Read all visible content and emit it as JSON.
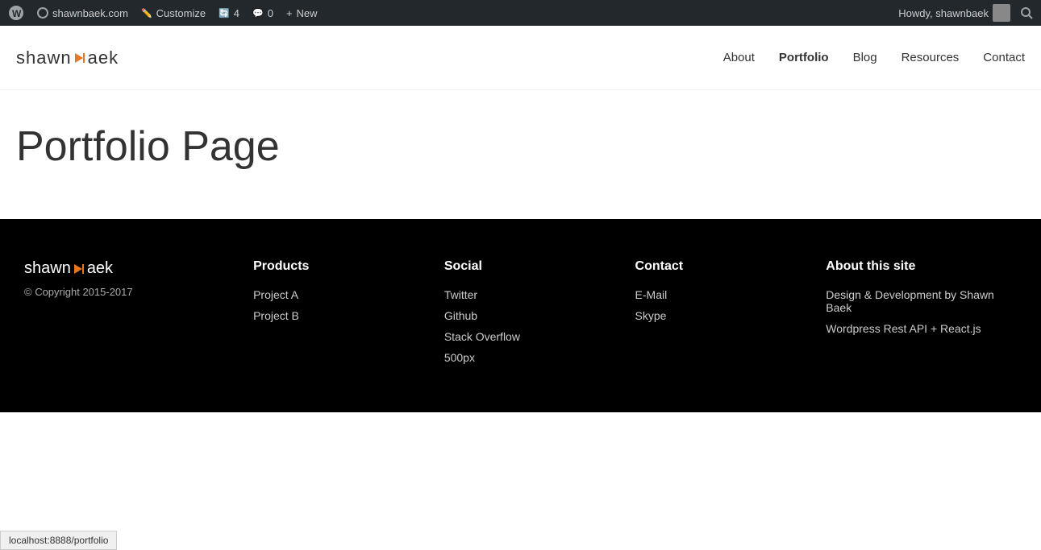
{
  "adminbar": {
    "wp_icon": "wordpress",
    "site_name": "shawnbaek.com",
    "customize_label": "Customize",
    "revisions_count": "4",
    "comments_count": "0",
    "new_label": "New",
    "howdy_label": "Howdy, shawnbaek",
    "search_icon": "search"
  },
  "header": {
    "logo_text_left": "shawn",
    "logo_text_right": "aek",
    "nav_items": [
      {
        "label": "About",
        "id": "about",
        "active": false
      },
      {
        "label": "Portfolio",
        "id": "portfolio",
        "active": true
      },
      {
        "label": "Blog",
        "id": "blog",
        "active": false
      },
      {
        "label": "Resources",
        "id": "resources",
        "active": false
      },
      {
        "label": "Contact",
        "id": "contact",
        "active": false
      }
    ]
  },
  "page": {
    "title": "Portfolio Page"
  },
  "footer": {
    "logo_text_left": "shawn",
    "logo_text_right": "aek",
    "copyright": "© Copyright 2015-2017",
    "products": {
      "title": "Products",
      "links": [
        {
          "label": "Project A"
        },
        {
          "label": "Project B"
        }
      ]
    },
    "social": {
      "title": "Social",
      "links": [
        {
          "label": "Twitter"
        },
        {
          "label": "Github"
        },
        {
          "label": "Stack Overflow"
        },
        {
          "label": "500px"
        }
      ]
    },
    "contact": {
      "title": "Contact",
      "links": [
        {
          "label": "E-Mail"
        },
        {
          "label": "Skype"
        }
      ]
    },
    "about": {
      "title": "About this site",
      "links": [
        {
          "label": "Design & Development by Shawn Baek"
        },
        {
          "label": "Wordpress Rest API + React.js"
        }
      ]
    }
  },
  "statusbar": {
    "url": "localhost:8888/portfolio"
  }
}
